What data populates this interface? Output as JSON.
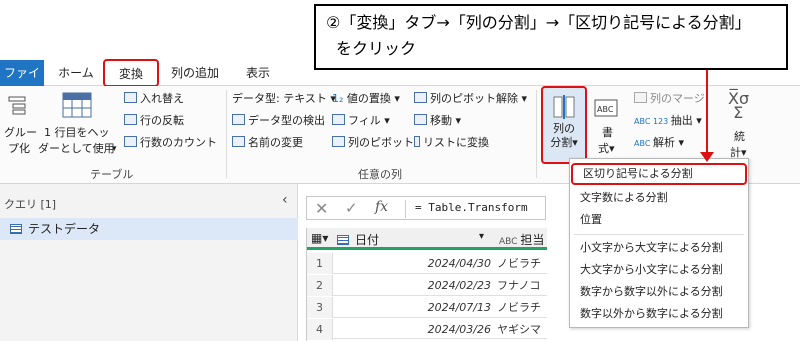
{
  "callout": {
    "line1": "②「変換」タブ→「列の分割」→「区切り記号による分割」",
    "line2": "をクリック"
  },
  "tabs": {
    "file": "ファイル",
    "home": "ホーム",
    "transform": "変換",
    "add_column": "列の追加",
    "view": "表示"
  },
  "ribbon": {
    "table_group": {
      "group_btn_line1": "グルー",
      "group_btn_line2": "プ化",
      "first_row_line1": "1 行目をヘッ",
      "first_row_line2": "ダーとして使用",
      "transpose": "入れ替え",
      "reverse_rows": "行の反転",
      "count_rows": "行数のカウント",
      "label": "テーブル"
    },
    "any_column_group": {
      "data_type": "データ型: テキスト",
      "detect_type": "データ型の検出",
      "rename": "名前の変更",
      "replace_values": "値の置換",
      "fill": "フィル",
      "pivot_column": "列のピボット",
      "unpivot": "列のピボット解除",
      "move": "移動",
      "to_list": "リストに変換",
      "label": "任意の列"
    },
    "text_column_group": {
      "split_line1": "列の",
      "split_line2": "分割",
      "format_line1": "書",
      "format_line2": "式",
      "merge_columns": "列のマージ",
      "extract": "抽出",
      "parse": "解析",
      "stats_line1": "統",
      "stats_line2": "計"
    }
  },
  "queries": {
    "header": "クエリ [1]",
    "items": [
      "テストデータ"
    ]
  },
  "formula": {
    "x": "✕",
    "check": "✓",
    "fx": "fx",
    "text": "= Table.Transform"
  },
  "grid": {
    "col_date": "日付",
    "col_owner": "担当",
    "rows": [
      {
        "num": "1",
        "date": "2024/04/30",
        "name": "ノビラチ"
      },
      {
        "num": "2",
        "date": "2024/02/23",
        "name": "フナノコ"
      },
      {
        "num": "3",
        "date": "2024/07/13",
        "name": "ノビラチ"
      },
      {
        "num": "4",
        "date": "2024/03/26",
        "name": "ヤギシマ"
      }
    ]
  },
  "split_menu": {
    "items": [
      "区切り記号による分割",
      "文字数による分割",
      "位置",
      "小文字から大文字による分割",
      "大文字から小文字による分割",
      "数字から数字以外による分割",
      "数字以外から数字による分割"
    ]
  },
  "colors": {
    "accent_red": "#dd1111",
    "file_tab": "#1f74c4",
    "grid_green": "#21a366"
  }
}
